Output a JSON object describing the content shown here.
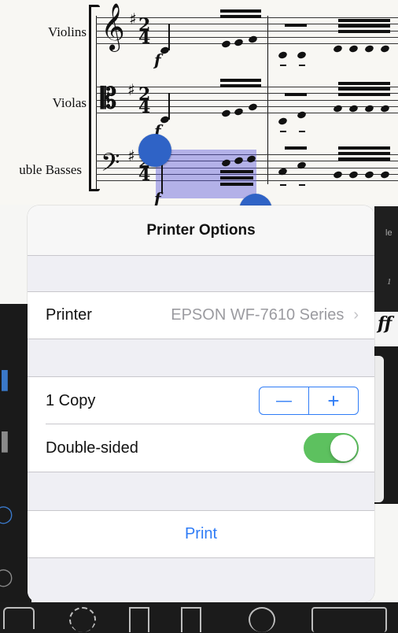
{
  "score": {
    "staff_labels": [
      "Violins",
      "Violas",
      "uble Basses"
    ],
    "dynamic_marks": [
      "f",
      "f",
      "f"
    ]
  },
  "background_panel": {
    "cut_text_top": "le",
    "cut_text_number": "1",
    "cut_dynamic": "ff"
  },
  "popover": {
    "title": "Printer Options",
    "printer_label": "Printer",
    "printer_value": "EPSON WF-7610 Series",
    "printer_chevron": "›",
    "copies_label": "1 Copy",
    "stepper_minus": "—",
    "stepper_plus": "+",
    "double_sided_label": "Double-sided",
    "double_sided_on": true,
    "print_label": "Print"
  },
  "colors": {
    "accent": "#2f7cf6",
    "toggle_on": "#5dc15f",
    "selection": "#6f68d9",
    "handle": "#2f63c6"
  },
  "icons": {
    "toolbar": [
      "house-icon",
      "gear-icon",
      "document-icon",
      "share-icon",
      "play-icon",
      "playback-icon"
    ]
  }
}
